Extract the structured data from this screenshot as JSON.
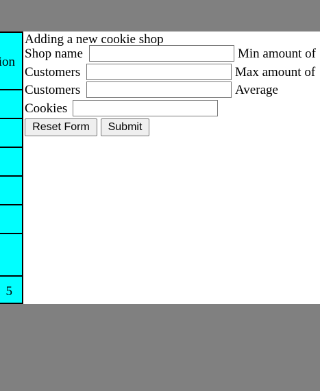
{
  "sidebar": {
    "items": [
      {
        "label": "ion"
      },
      {
        "label": ""
      },
      {
        "label": ""
      },
      {
        "label": ""
      },
      {
        "label": ""
      },
      {
        "label": ""
      },
      {
        "label": ""
      },
      {
        "label": "5"
      }
    ]
  },
  "form": {
    "title": "Adding a new cookie shop",
    "fields": {
      "shop_name": {
        "label": "Shop name",
        "value": ""
      },
      "min_customers": {
        "label": "Min amount of",
        "value": ""
      },
      "customers_1": {
        "label": "Customers",
        "value": ""
      },
      "max_customers": {
        "label": "Max amount of",
        "value": ""
      },
      "customers_2": {
        "label": "Customers",
        "value": ""
      },
      "average": {
        "label": "Average",
        "value": ""
      },
      "cookies": {
        "label": "Cookies",
        "value": ""
      }
    },
    "buttons": {
      "reset": "Reset Form",
      "submit": "Submit"
    }
  },
  "colors": {
    "background": "#808080",
    "panel": "#ffffff",
    "sidebar": "#00ffff"
  }
}
